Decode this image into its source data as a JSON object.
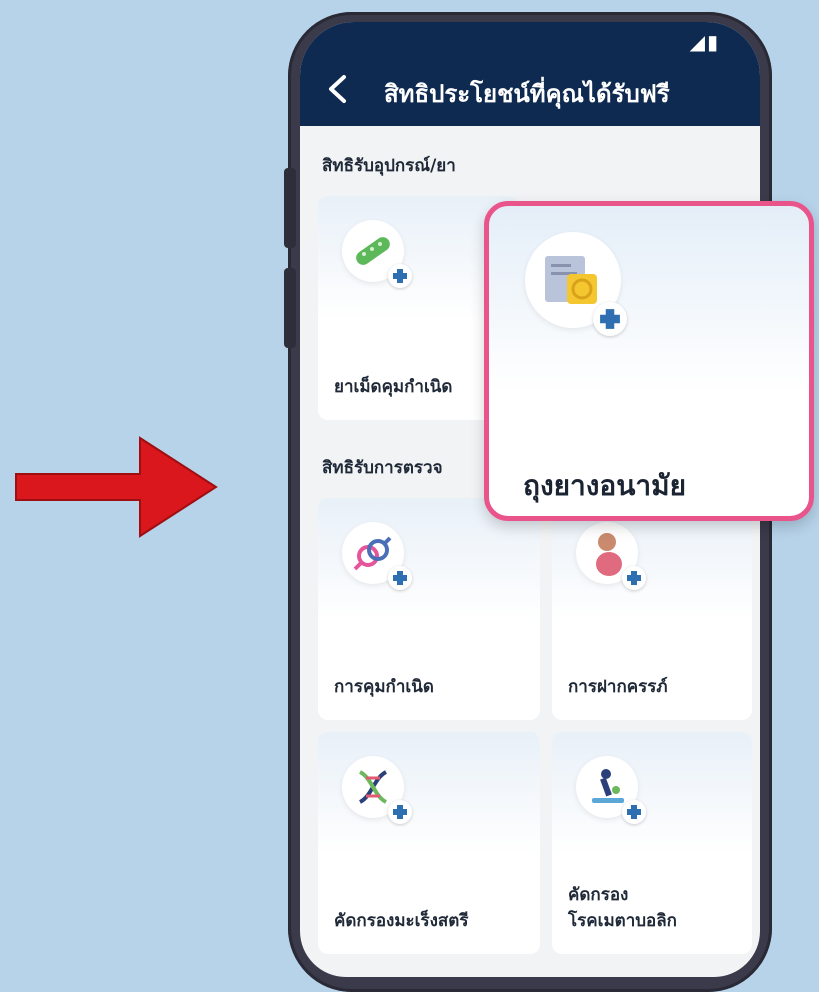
{
  "header": {
    "title": "สิทธิประโยชน์ที่คุณได้รับฟรี",
    "status_icons": "◢▮"
  },
  "sections": [
    {
      "label": "สิทธิรับอุปกรณ์/ยา"
    },
    {
      "label": "สิทธิรับการตรวจ"
    }
  ],
  "cards": [
    {
      "label": "ยาเม็ดคุมกำเนิด",
      "icon": "pill-pack-icon"
    },
    {
      "label": "การคุมกำเนิด",
      "icon": "gender-symbol-icon"
    },
    {
      "label": "การฝากครรภ์",
      "icon": "pregnancy-icon"
    },
    {
      "label": "คัดกรองมะเร็งสตรี",
      "icon": "dna-icon"
    },
    {
      "label_line1": "คัดกรอง",
      "label_line2": "โรคเมตาบอลิก",
      "icon": "microscope-icon"
    }
  ],
  "popup": {
    "label": "ถุงยางอนามัย",
    "icon": "condom-pack-icon"
  },
  "colors": {
    "header_bg": "#0e2a50",
    "popup_border": "#e9548a",
    "arrow": "#d9171c",
    "background": "#b7d3ea"
  }
}
